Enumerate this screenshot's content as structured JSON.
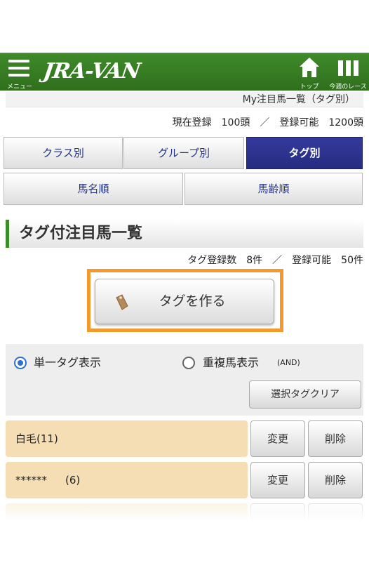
{
  "header": {
    "menu_label": "メニュー",
    "logo": "JRA-VAN",
    "top_label": "トップ",
    "week_label": "今週のレース",
    "brand_color": "#2f6f1c"
  },
  "breadcrumb": "My注目馬一覧（タグ別）",
  "registration": "現在登録　100頭　／　登録可能　1200頭",
  "tabs_row1": [
    {
      "label": "クラス別"
    },
    {
      "label": "グループ別"
    },
    {
      "label": "タグ別",
      "active": true
    }
  ],
  "tabs_row2": [
    {
      "label": "馬名順"
    },
    {
      "label": "馬齢順"
    }
  ],
  "section": {
    "title": "タグ付注目馬一覧",
    "tag_count": "タグ登録数　8件　／　登録可能　50件",
    "make_tag_button": "タグを作る"
  },
  "filter": {
    "single_tag": "単一タグ表示",
    "duplicate": "重複馬表示",
    "and_label": "(AND)",
    "clear_button": "選択タグクリア"
  },
  "tags": [
    {
      "name": "白毛",
      "count": "(11)",
      "change": "変更",
      "delete": "削除"
    },
    {
      "name": "******",
      "count": "(6)",
      "change": "変更",
      "delete": "削除"
    }
  ],
  "colors": {
    "active_tab": "#2b3190",
    "highlight": "#f29a2e",
    "tag_row": "#f5deb3"
  }
}
